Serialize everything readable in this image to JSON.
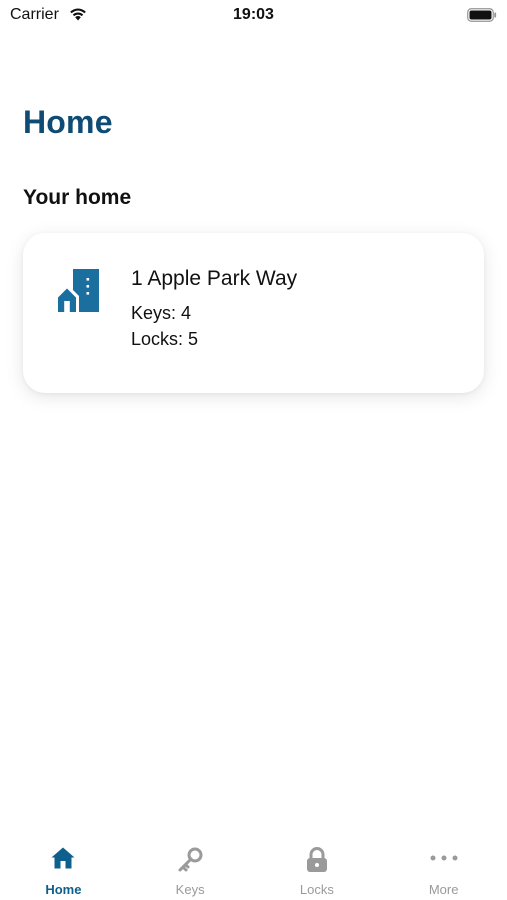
{
  "status_bar": {
    "carrier": "Carrier",
    "time": "19:03",
    "wifi_icon": "wifi-icon",
    "battery_icon": "battery-icon"
  },
  "header": {
    "title": "Home"
  },
  "section": {
    "title": "Your home"
  },
  "home_card": {
    "icon": "building-icon",
    "address": "1 Apple Park Way",
    "keys_text": "Keys: 4",
    "locks_text": "Locks: 5"
  },
  "tab_bar": {
    "tabs": [
      {
        "label": "Home",
        "icon": "home-icon",
        "active": true
      },
      {
        "label": "Keys",
        "icon": "key-icon",
        "active": false
      },
      {
        "label": "Locks",
        "icon": "lock-icon",
        "active": false
      },
      {
        "label": "More",
        "icon": "more-icon",
        "active": false
      }
    ]
  },
  "colors": {
    "accent": "#0f5f8c",
    "title": "#0f4c75",
    "icon_blue": "#1b6f9e",
    "inactive": "#9a9a9a"
  }
}
